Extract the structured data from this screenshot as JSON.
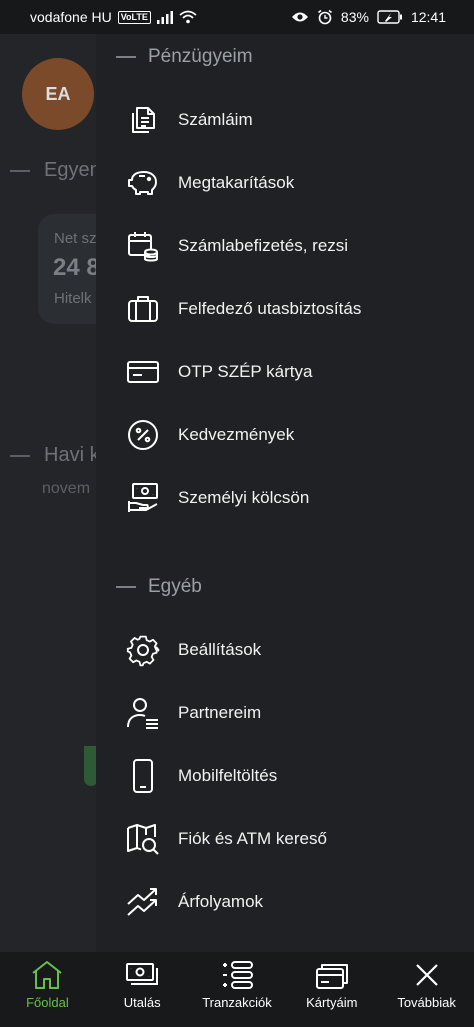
{
  "status_bar": {
    "carrier": "vodafone HU",
    "volte": "VoLTE",
    "battery": "83%",
    "time": "12:41"
  },
  "background": {
    "avatar_initials": "EA",
    "section1": "Egyen",
    "card_line1": "Net sz",
    "card_line2": "24 8",
    "card_line3": "Hitelk",
    "section2": "Havi k",
    "subtitle": "novem"
  },
  "drawer": {
    "section1_title": "Pénzügyeim",
    "section1_items": [
      {
        "label": "Számláim",
        "icon": "document-icon"
      },
      {
        "label": "Megtakarítások",
        "icon": "piggy-bank-icon"
      },
      {
        "label": "Számlabefizetés, rezsi",
        "icon": "calendar-coins-icon"
      },
      {
        "label": "Felfedező utasbiztosítás",
        "icon": "suitcase-icon"
      },
      {
        "label": "OTP SZÉP kártya",
        "icon": "card-icon"
      },
      {
        "label": "Kedvezmények",
        "icon": "percent-icon"
      },
      {
        "label": "Személyi kölcsön",
        "icon": "cash-hand-icon"
      }
    ],
    "section2_title": "Egyéb",
    "section2_items": [
      {
        "label": "Beállítások",
        "icon": "gear-icon"
      },
      {
        "label": "Partnereim",
        "icon": "person-list-icon"
      },
      {
        "label": "Mobilfeltöltés",
        "icon": "phone-icon"
      },
      {
        "label": "Fiók és ATM kereső",
        "icon": "map-search-icon"
      },
      {
        "label": "Árfolyamok",
        "icon": "trend-icon"
      }
    ]
  },
  "bottom_nav": [
    {
      "label": "Főoldal",
      "icon": "home-icon",
      "active": true
    },
    {
      "label": "Utalás",
      "icon": "money-icon",
      "active": false
    },
    {
      "label": "Tranzakciók",
      "icon": "list-icon",
      "active": false
    },
    {
      "label": "Kártyáim",
      "icon": "cards-icon",
      "active": false
    },
    {
      "label": "Továbbiak",
      "icon": "close-icon",
      "active": false
    }
  ],
  "colors": {
    "accent_green": "#6abf4b",
    "drawer_bg": "#1f2124"
  }
}
